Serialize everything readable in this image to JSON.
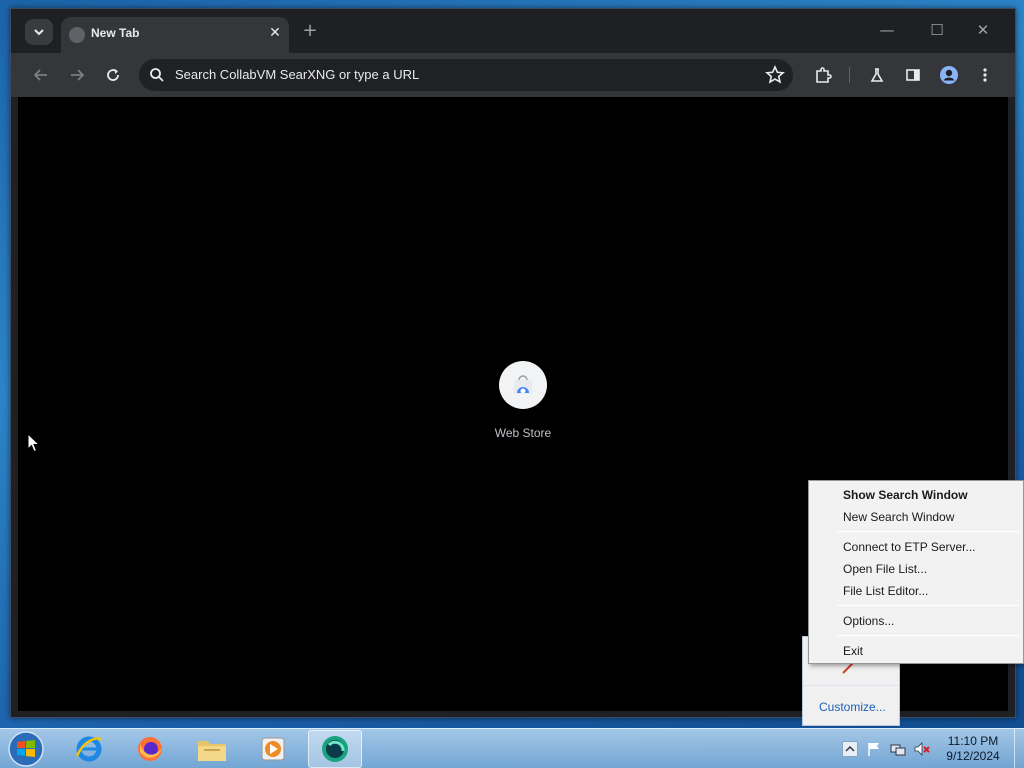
{
  "browser": {
    "tab_title": "New Tab",
    "omnibox_placeholder": "Search CollabVM SearXNG or type a URL",
    "shortcut_label": "Web Store"
  },
  "tray_popup": {
    "customize_label": "Customize..."
  },
  "context_menu": {
    "items": [
      {
        "label": "Show Search Window"
      },
      {
        "label": "New Search Window"
      },
      {
        "label": "Connect to ETP Server..."
      },
      {
        "label": "Open File List..."
      },
      {
        "label": "File List Editor..."
      },
      {
        "label": "Options..."
      },
      {
        "label": "Exit"
      }
    ]
  },
  "taskbar": {
    "time": "11:10 PM",
    "date": "9/12/2024"
  }
}
